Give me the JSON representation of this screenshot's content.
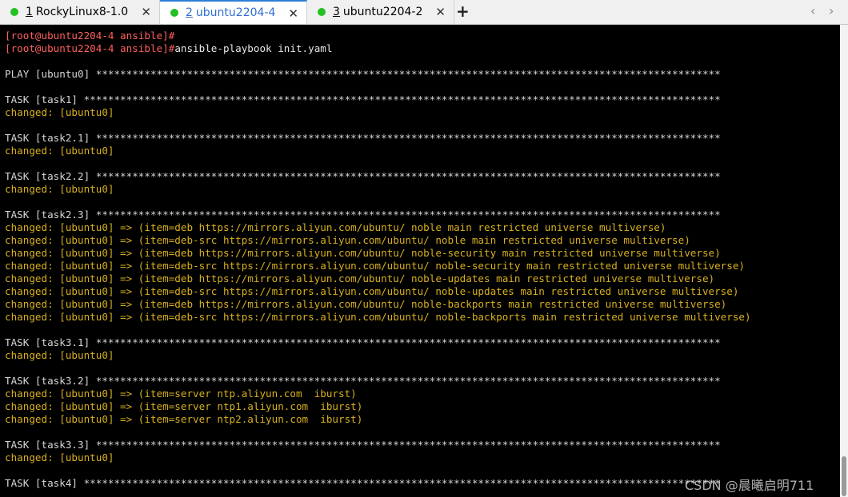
{
  "tabs": [
    {
      "num": "1",
      "label": "RockyLinux8-1.0",
      "close": "✕",
      "dot_color": "#22c022"
    },
    {
      "num": "2",
      "label": "ubuntu2204-4",
      "close": "✕",
      "dot_color": "#22c022"
    },
    {
      "num": "3",
      "label": "ubuntu2204-2",
      "close": "✕",
      "dot_color": "#22c022"
    }
  ],
  "new_tab": "+",
  "nav": {
    "prev": "‹",
    "next": "›"
  },
  "terminal": {
    "prompt1": "[root@ubuntu2204-4 ansible]#",
    "prompt2": "[root@ubuntu2204-4 ansible]#",
    "command": "ansible-playbook init.yaml",
    "play": "PLAY [ubuntu0] *******************************************************************************************************",
    "task1": "TASK [task1] *********************************************************************************************************",
    "task1_result": "changed: [ubuntu0]",
    "task21": "TASK [task2.1] *******************************************************************************************************",
    "task21_result": "changed: [ubuntu0]",
    "task22": "TASK [task2.2] *******************************************************************************************************",
    "task22_result": "changed: [ubuntu0]",
    "task23": "TASK [task2.3] *******************************************************************************************************",
    "task23_results": [
      "changed: [ubuntu0] => (item=deb https://mirrors.aliyun.com/ubuntu/ noble main restricted universe multiverse)",
      "changed: [ubuntu0] => (item=deb-src https://mirrors.aliyun.com/ubuntu/ noble main restricted universe multiverse)",
      "changed: [ubuntu0] => (item=deb https://mirrors.aliyun.com/ubuntu/ noble-security main restricted universe multiverse)",
      "changed: [ubuntu0] => (item=deb-src https://mirrors.aliyun.com/ubuntu/ noble-security main restricted universe multiverse)",
      "changed: [ubuntu0] => (item=deb https://mirrors.aliyun.com/ubuntu/ noble-updates main restricted universe multiverse)",
      "changed: [ubuntu0] => (item=deb-src https://mirrors.aliyun.com/ubuntu/ noble-updates main restricted universe multiverse)",
      "changed: [ubuntu0] => (item=deb https://mirrors.aliyun.com/ubuntu/ noble-backports main restricted universe multiverse)",
      "changed: [ubuntu0] => (item=deb-src https://mirrors.aliyun.com/ubuntu/ noble-backports main restricted universe multiverse)"
    ],
    "task31": "TASK [task3.1] *******************************************************************************************************",
    "task31_result": "changed: [ubuntu0]",
    "task32": "TASK [task3.2] *******************************************************************************************************",
    "task32_results": [
      "changed: [ubuntu0] => (item=server ntp.aliyun.com  iburst)",
      "changed: [ubuntu0] => (item=server ntp1.aliyun.com  iburst)",
      "changed: [ubuntu0] => (item=server ntp2.aliyun.com  iburst)"
    ],
    "task33": "TASK [task3.3] *******************************************************************************************************",
    "task33_result": "changed: [ubuntu0]",
    "task4": "TASK [task4] *********************************************************************************************************"
  },
  "watermark": "CSDN @晨曦启明711",
  "colors": {
    "prompt": "#ff5f5f",
    "changed": "#d7b01e",
    "normal": "#d6d6d6",
    "tab_accent": "#2f7fd9"
  }
}
